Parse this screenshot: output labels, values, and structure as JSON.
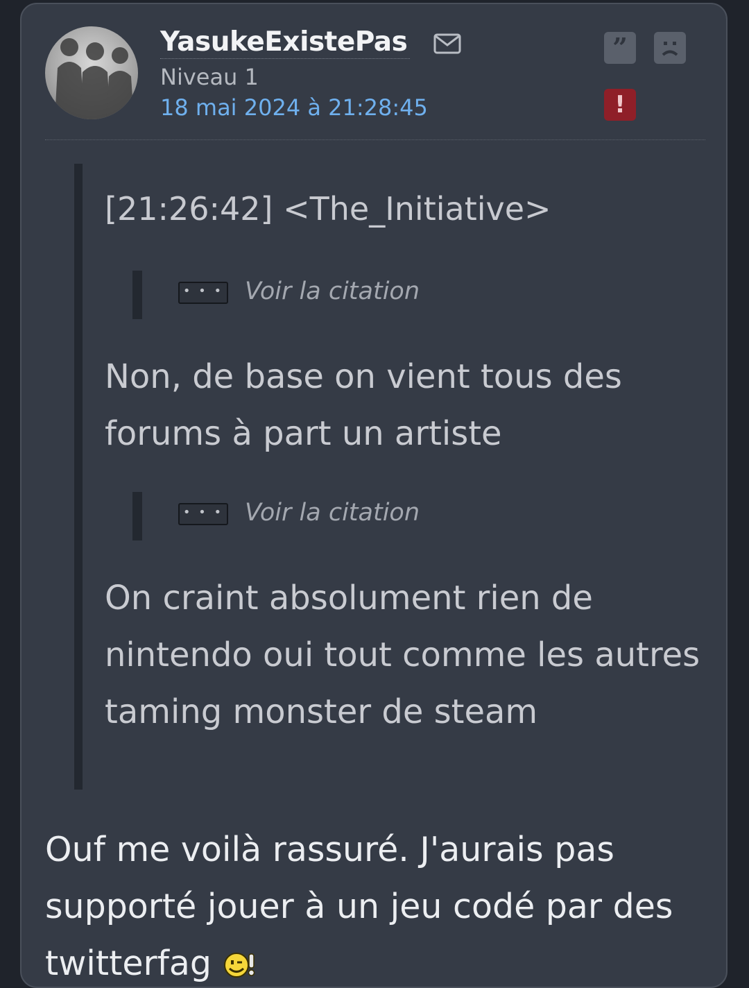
{
  "post": {
    "author": "YasukeExistePas",
    "level": "Niveau 1",
    "date": "18 mai 2024 à 21:28:45",
    "quote": {
      "header": "[21:26:42] <The_Initiative>",
      "nested_label": "Voir la citation",
      "nested_dots": "• • •",
      "paragraphs": [
        "Non, de base on vient tous des forums à part un artiste",
        "On craint absolument rien de nintendo oui tout comme les autres taming monster de steam"
      ]
    },
    "body": "Ouf me voilà rassuré. J'aurais pas supporté jouer à un jeu codé par des twitterfag"
  },
  "icons": {
    "mail": "mail-icon",
    "quote": "quote-icon",
    "sad": "sad-face-icon",
    "alert": "alert-icon",
    "smiley": "wink-smiley-icon"
  },
  "colors": {
    "card_bg": "#353b46",
    "date_link": "#6fb0ee",
    "alert_bg": "#8f1f28"
  }
}
